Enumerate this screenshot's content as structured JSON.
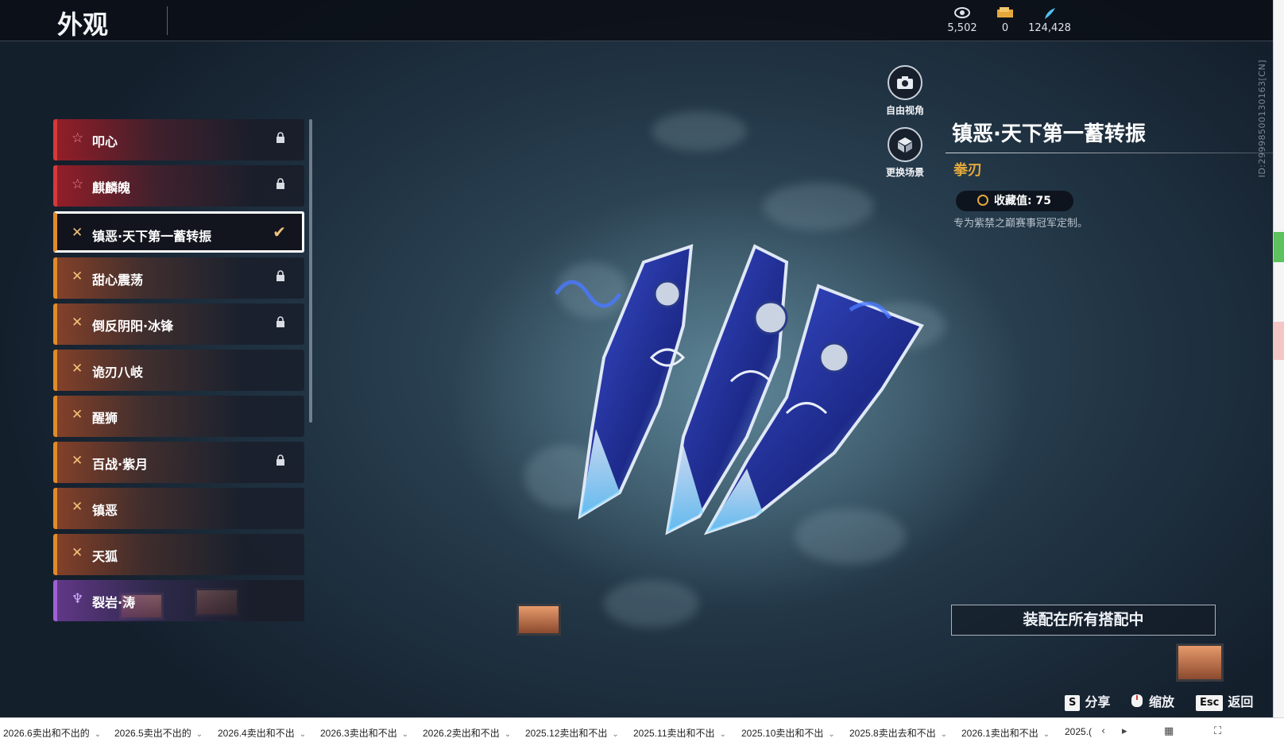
{
  "header": {
    "title": "外观",
    "currencies": [
      {
        "icon": "spiral-shell-icon",
        "value": "5,502"
      },
      {
        "icon": "ticket-icon",
        "value": "0"
      },
      {
        "icon": "feather-icon",
        "value": "124,428"
      }
    ]
  },
  "side_id": "ID:2999850013016​3[CN]",
  "skins": [
    {
      "label": "叩心",
      "rarity": "red",
      "locked": true,
      "selected": false
    },
    {
      "label": "麒麟魄",
      "rarity": "red",
      "locked": true,
      "selected": false
    },
    {
      "label": "镇恶·天下第一蓄转振",
      "rarity": "gold",
      "locked": false,
      "selected": true
    },
    {
      "label": "甜心震荡",
      "rarity": "gold",
      "locked": true,
      "selected": false
    },
    {
      "label": "倒反阴阳·冰锋",
      "rarity": "gold",
      "locked": true,
      "selected": false
    },
    {
      "label": "诡刃八岐",
      "rarity": "gold",
      "locked": false,
      "selected": false
    },
    {
      "label": "醒狮",
      "rarity": "gold",
      "locked": false,
      "selected": false
    },
    {
      "label": "百战·紫月",
      "rarity": "gold",
      "locked": true,
      "selected": false
    },
    {
      "label": "镇恶",
      "rarity": "gold",
      "locked": false,
      "selected": false
    },
    {
      "label": "天狐",
      "rarity": "gold",
      "locked": false,
      "selected": false
    },
    {
      "label": "裂岩·涛",
      "rarity": "purple",
      "locked": false,
      "selected": false
    }
  ],
  "view_controls": {
    "free_view": "自由视角",
    "change_scene": "更换场景"
  },
  "item": {
    "name": "镇恶·天下第一蓄转振",
    "type": "拳刃",
    "collection": "收藏值: 75",
    "description": "专为紫禁之巅赛事冠军定制。"
  },
  "equip_all_label": "装配在所有搭配中",
  "hotkeys": [
    {
      "key": "S",
      "label": "分享"
    },
    {
      "key": "",
      "label": "缩放"
    },
    {
      "key": "Esc",
      "label": "返回"
    }
  ],
  "sheet_tabs": [
    "2026.6卖出和不出的",
    "2026.5卖出不出的",
    "2026.4卖出和不出",
    "2026.3卖出和不出",
    "2026.2卖出和不出",
    "2025.12卖出和不出",
    "2025.11卖出和不出",
    "2025.10卖出和不出",
    "2025.8卖出去和不出",
    "2026.1卖出和不出",
    "2025.("
  ],
  "colors": {
    "accent_gold": "#e2a83c",
    "rarity_red": "#d33a3a",
    "rarity_gold": "#e08b2a",
    "rarity_purple": "#a061d6"
  }
}
